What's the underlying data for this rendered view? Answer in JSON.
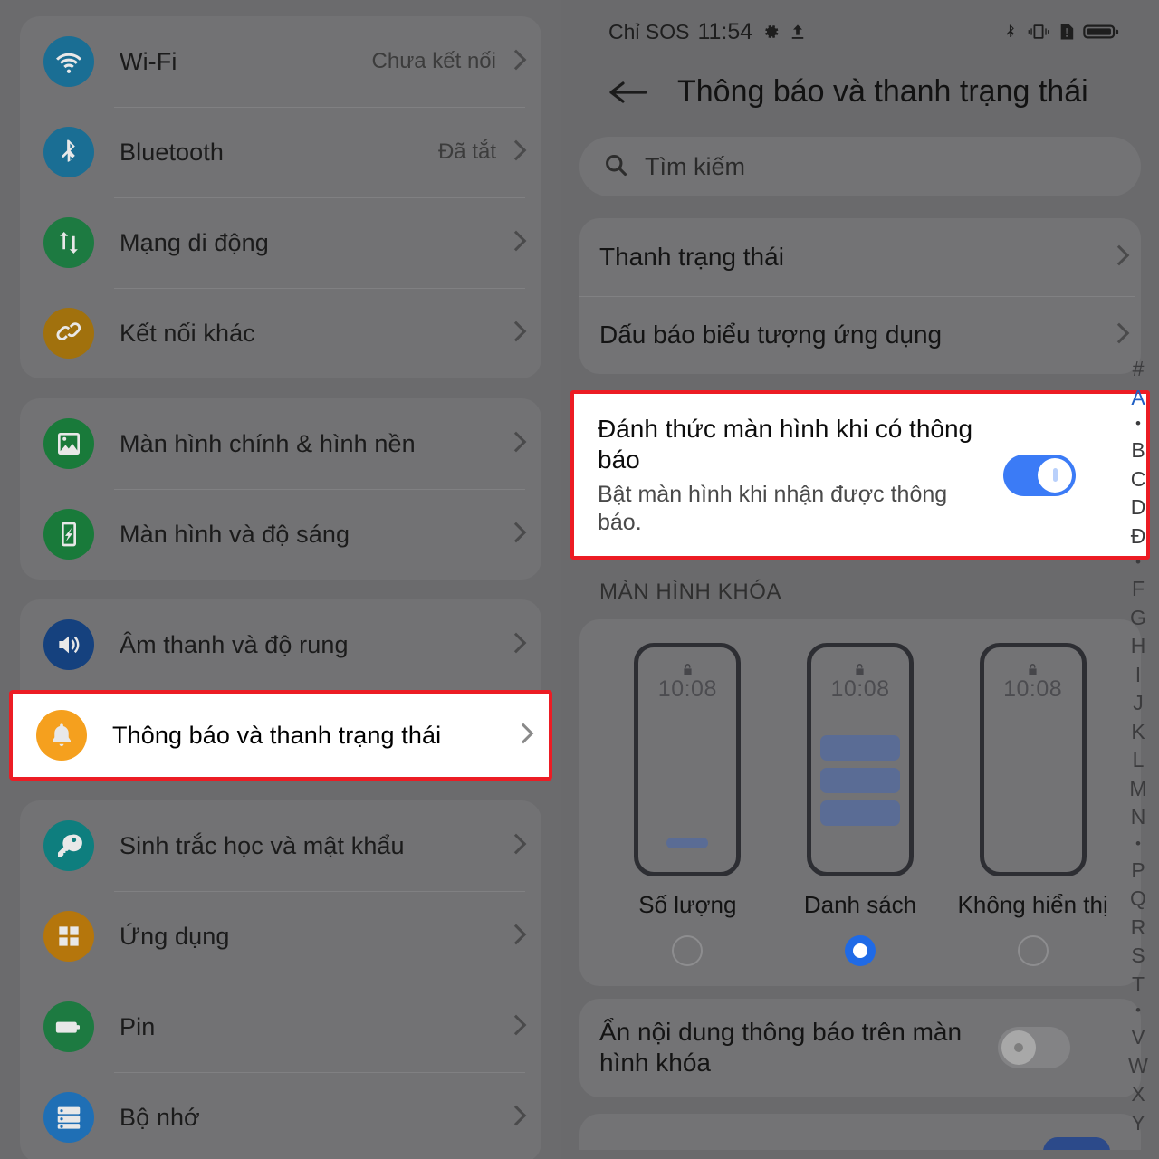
{
  "left_panel": {
    "groups": [
      {
        "items": [
          {
            "icon": "wifi-icon",
            "label": "Wi-Fi",
            "value": "Chưa kết nối",
            "color": "#1a6e94"
          },
          {
            "icon": "bluetooth-icon",
            "label": "Bluetooth",
            "value": "Đã tắt",
            "color": "#1a6e94"
          },
          {
            "icon": "mobile-network-icon",
            "label": "Mạng di động",
            "value": "",
            "color": "#1d7a41"
          },
          {
            "icon": "link-icon",
            "label": "Kết nối khác",
            "value": "",
            "color": "#a1710d"
          }
        ]
      },
      {
        "items": [
          {
            "icon": "wallpaper-icon",
            "label": "Màn hình chính & hình nền",
            "value": "",
            "color": "#197a3a"
          },
          {
            "icon": "brightness-icon",
            "label": "Màn hình và độ sáng",
            "value": "",
            "color": "#197a3a"
          }
        ]
      },
      {
        "items": [
          {
            "icon": "volume-icon",
            "label": "Âm thanh và độ rung",
            "value": "",
            "color": "#15417e"
          }
        ]
      },
      {
        "highlighted": true,
        "items": [
          {
            "icon": "bell-icon",
            "label": "Thông báo và thanh trạng thái",
            "value": "",
            "color": "#f5a01e"
          }
        ]
      },
      {
        "items": [
          {
            "icon": "key-icon",
            "label": "Sinh trắc học và mật khẩu",
            "value": "",
            "color": "#0e7e7e"
          },
          {
            "icon": "apps-grid-icon",
            "label": "Ứng dụng",
            "value": "",
            "color": "#b5760c"
          },
          {
            "icon": "battery-icon",
            "label": "Pin",
            "value": "",
            "color": "#1d7a41"
          },
          {
            "icon": "storage-icon",
            "label": "Bộ nhớ",
            "value": "",
            "color": "#1f6fb5"
          }
        ]
      }
    ]
  },
  "right_panel": {
    "status_bar": {
      "carrier": "Chỉ SOS",
      "time": "11:54",
      "left_icons": [
        "gear-icon",
        "upload-icon"
      ],
      "right_icons": [
        "bluetooth-icon",
        "vibrate-icon",
        "sim-alert-icon",
        "battery-icon"
      ]
    },
    "header": {
      "back_icon": "back-arrow-icon",
      "title": "Thông báo và thanh trạng thái"
    },
    "search": {
      "icon": "search-icon",
      "placeholder": "Tìm kiếm"
    },
    "list_card": {
      "rows": [
        {
          "label": "Thanh trạng thái",
          "chevron": true
        },
        {
          "label": "Dấu báo biểu tượng ứng dụng",
          "chevron": true
        }
      ]
    },
    "wake_screen": {
      "title": "Đánh thức màn hình khi có thông báo",
      "subtitle": "Bật màn hình khi nhận được thông báo.",
      "toggle_on": true,
      "highlight_color": "#ec1c24",
      "accent_color": "#3b7bf6"
    },
    "lock_section": {
      "header": "MÀN HÌNH KHÓA",
      "options": [
        {
          "label": "Số lượng",
          "selected": false,
          "preview_time": "10:08",
          "preview_type": "count"
        },
        {
          "label": "Danh sách",
          "selected": true,
          "preview_time": "10:08",
          "preview_type": "list"
        },
        {
          "label": "Không hiển thị",
          "selected": false,
          "preview_time": "10:08",
          "preview_type": "none"
        }
      ],
      "hide_content_row": {
        "label": "Ẩn nội dung thông báo trên màn hình khóa",
        "toggle_on": false
      }
    },
    "alpha_index": [
      "#",
      "A",
      "•",
      "B",
      "C",
      "D",
      "Đ",
      "•",
      "F",
      "G",
      "H",
      "I",
      "J",
      "K",
      "L",
      "M",
      "N",
      "•",
      "P",
      "Q",
      "R",
      "S",
      "T",
      "•",
      "V",
      "W",
      "X",
      "Y"
    ],
    "alpha_active": "A"
  }
}
